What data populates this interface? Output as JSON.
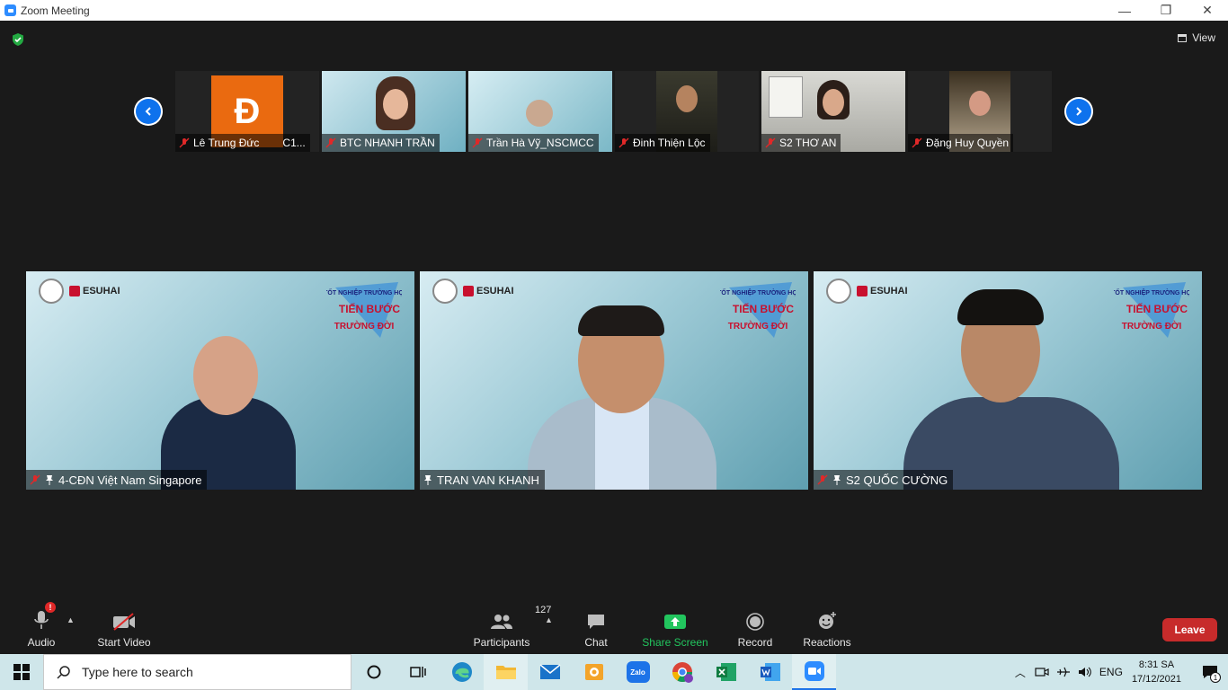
{
  "window": {
    "title": "Zoom Meeting",
    "minimize": "—",
    "restore": "❐",
    "close": "✕"
  },
  "header": {
    "view_label": "View"
  },
  "thumbnails": [
    {
      "name": "Lê Trung Đức",
      "extra": "C1...",
      "avatar_letter": "Đ",
      "muted": true
    },
    {
      "name": "BTC NHANH TRẦN",
      "muted": true
    },
    {
      "name": "Trần Hà Vỹ_NSCMCC",
      "muted": true
    },
    {
      "name": "Đinh Thiện Lộc",
      "muted": true
    },
    {
      "name": "S2 THƠ AN",
      "muted": true
    },
    {
      "name": "Đặng Huy Quyền",
      "muted": true
    }
  ],
  "main_videos": [
    {
      "name": "4-CĐN Việt Nam Singapore",
      "muted": true,
      "pinned": true
    },
    {
      "name": "TRAN VAN KHANH",
      "muted": false,
      "pinned": true
    },
    {
      "name": "S2 QUỐC CƯỜNG",
      "muted": true,
      "pinned": true
    }
  ],
  "branding": {
    "company": "ESUHAI",
    "banner_line1": "TỐT NGHIỆP TRƯỜNG HỌC",
    "banner_line2": "TIẾN BƯỚC",
    "banner_line3": "TRƯỜNG ĐỜI"
  },
  "toolbar": {
    "audio_label": "Audio",
    "audio_alert": "!",
    "video_label": "Start Video",
    "participants_label": "Participants",
    "participants_count": "127",
    "chat_label": "Chat",
    "share_label": "Share Screen",
    "record_label": "Record",
    "reactions_label": "Reactions",
    "leave_label": "Leave"
  },
  "taskbar": {
    "search_placeholder": "Type here to search",
    "language": "ENG",
    "time": "8:31 SA",
    "date": "17/12/2021",
    "notifications": "1",
    "zalo_label": "Zalo"
  },
  "colors": {
    "zoom_blue": "#0e72ed",
    "share_green": "#22c55e",
    "leave_red": "#c72b2b",
    "muted_red": "#e02828",
    "taskbar_bg": "#cfe6ea"
  }
}
